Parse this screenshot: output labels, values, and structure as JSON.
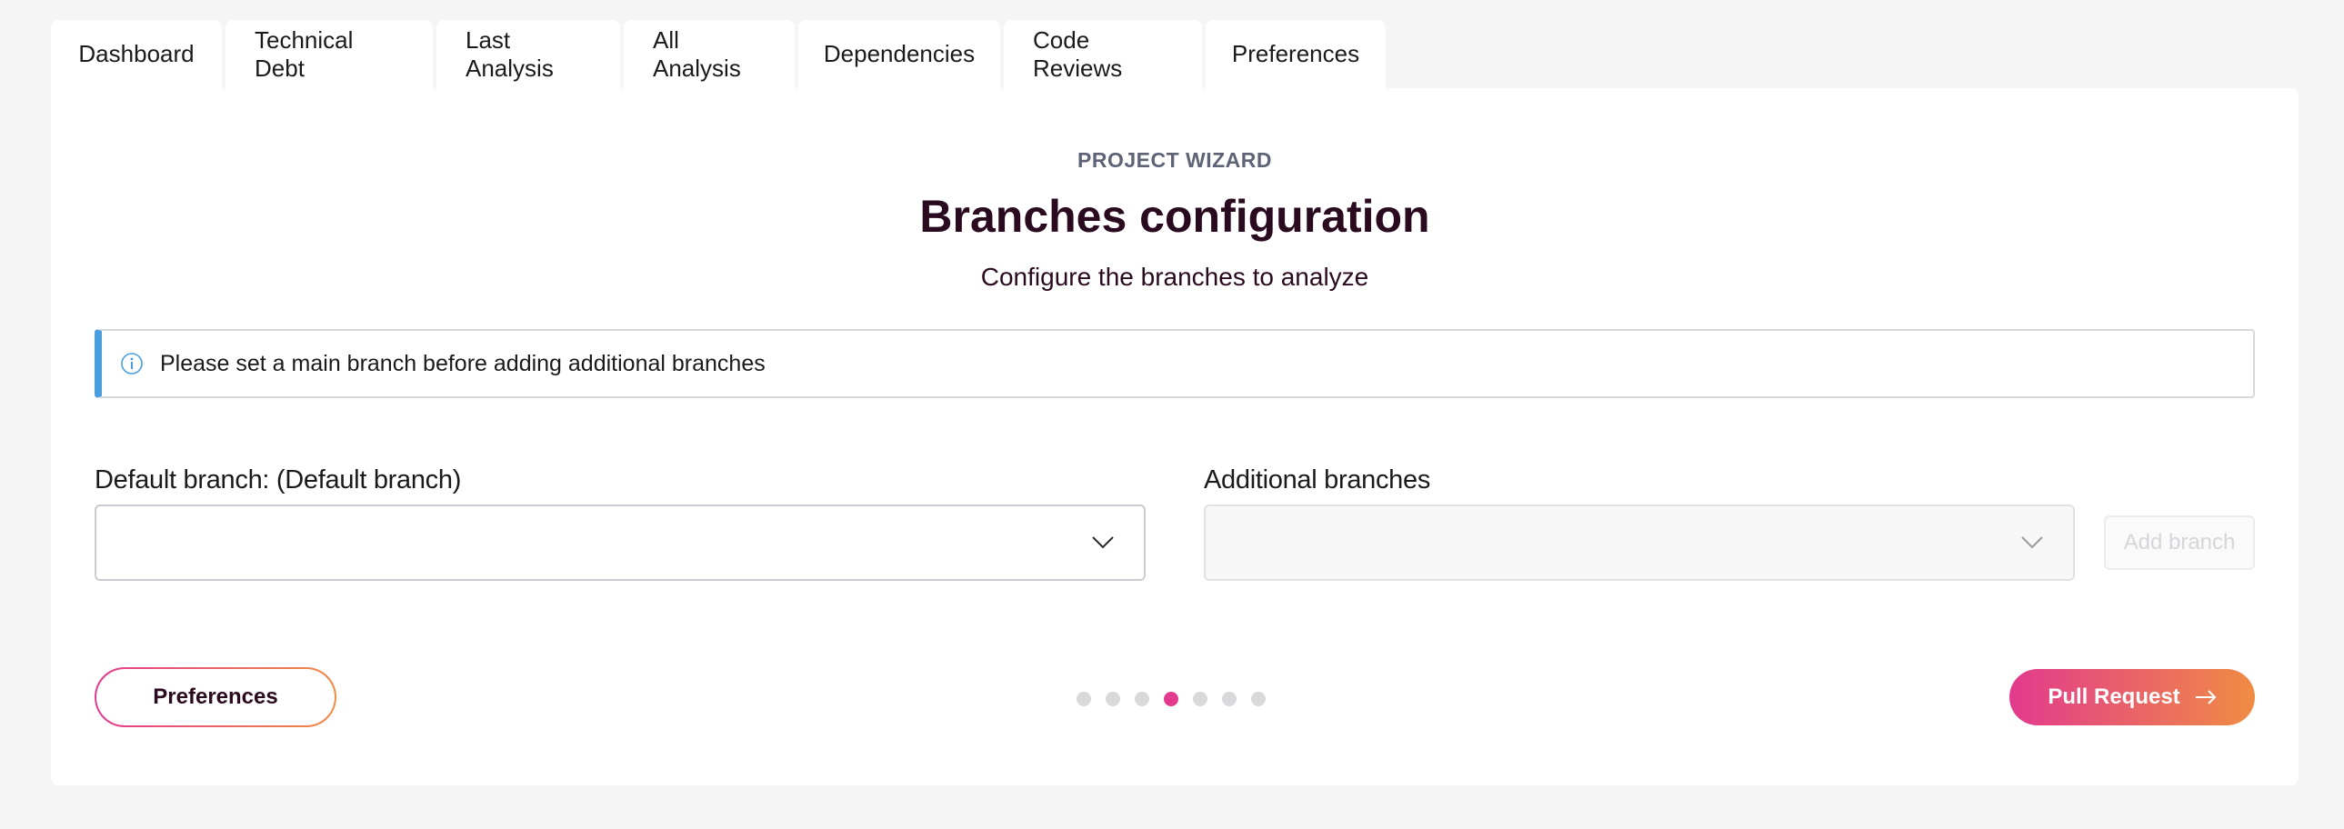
{
  "tabs": [
    {
      "label": "Dashboard"
    },
    {
      "label": "Technical Debt"
    },
    {
      "label": "Last Analysis"
    },
    {
      "label": "All Analysis"
    },
    {
      "label": "Dependencies"
    },
    {
      "label": "Code Reviews"
    },
    {
      "label": "Preferences"
    }
  ],
  "wizard": {
    "eyebrow": "PROJECT WIZARD",
    "title": "Branches configuration",
    "subtitle": "Configure the branches to analyze"
  },
  "info": {
    "icon": "info-icon",
    "message": "Please set a main branch before adding additional branches",
    "accent_color": "#4a9fdf"
  },
  "default_branch": {
    "label": "Default branch: (Default branch)",
    "value": ""
  },
  "additional_branches": {
    "label": "Additional branches",
    "value": "",
    "disabled": true,
    "add_button_label": "Add branch"
  },
  "footer": {
    "back_label": "Preferences",
    "next_label": "Pull Request",
    "steps_total": 7,
    "current_step": 4
  },
  "colors": {
    "brand_pink": "#e23a8d",
    "brand_orange": "#f08c44",
    "title_color": "#2a0a1f"
  }
}
